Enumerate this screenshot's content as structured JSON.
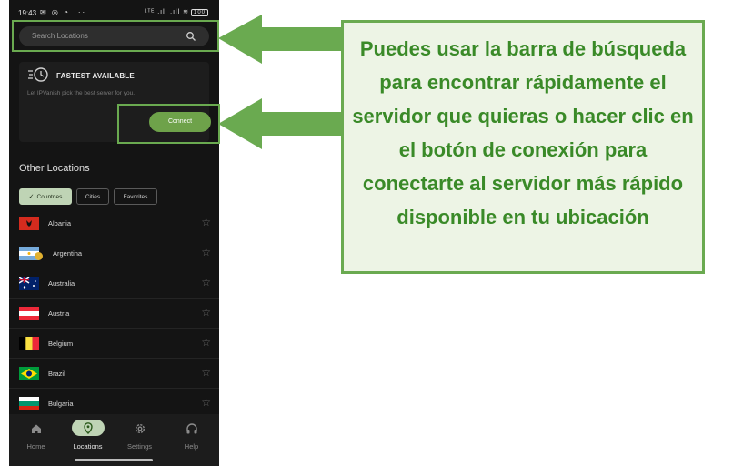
{
  "status_bar": {
    "time": "19:43",
    "left_icons": "✉ ◎ ◔ ···",
    "right_icons": "ᴸᵀᴱ .ıll .ıll",
    "battery": "100"
  },
  "search": {
    "placeholder": "Search Locations",
    "icon": "search-icon"
  },
  "fastest": {
    "title": "FASTEST AVAILABLE",
    "subtitle": "Let IPVanish pick the best server for you.",
    "connect_label": "Connect",
    "icon": "bolt-clock-icon"
  },
  "other_locations": {
    "title": "Other Locations",
    "filters": [
      {
        "label": "Countries",
        "active": true
      },
      {
        "label": "Cities",
        "active": false
      },
      {
        "label": "Favorites",
        "active": false
      }
    ],
    "countries": [
      {
        "name": "Albania",
        "flag": "albania"
      },
      {
        "name": "Argentina",
        "flag": "argentina"
      },
      {
        "name": "Australia",
        "flag": "australia"
      },
      {
        "name": "Austria",
        "flag": "austria"
      },
      {
        "name": "Belgium",
        "flag": "belgium"
      },
      {
        "name": "Brazil",
        "flag": "brazil"
      },
      {
        "name": "Bulgaria",
        "flag": "bulgaria"
      }
    ]
  },
  "nav": [
    {
      "label": "Home",
      "icon": "home-icon",
      "active": false
    },
    {
      "label": "Locations",
      "icon": "location-pin-icon",
      "active": true
    },
    {
      "label": "Settings",
      "icon": "gear-icon",
      "active": false
    },
    {
      "label": "Help",
      "icon": "headset-icon",
      "active": false
    }
  ],
  "callout": {
    "text": "Puedes usar la barra de búsqueda para encontrar rápidamente el servidor que quieras o hacer clic en el botón de conexión para conectarte al servidor más rápido disponible en tu ubicación"
  },
  "colors": {
    "accent_green": "#6aaa50",
    "callout_bg": "#edf4e5",
    "callout_text": "#3a8a28",
    "connect_button": "#6ea24a",
    "chip_active": "#bfd4b5",
    "app_bg": "#141414"
  }
}
